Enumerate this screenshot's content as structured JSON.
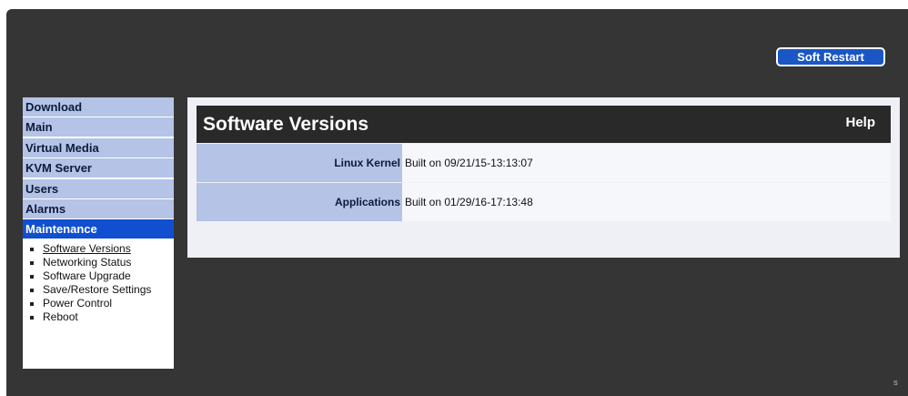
{
  "header": {
    "soft_restart_label": "Soft Restart"
  },
  "sidebar": {
    "items": [
      {
        "label": "Download"
      },
      {
        "label": "Main"
      },
      {
        "label": "Virtual Media"
      },
      {
        "label": "KVM Server"
      },
      {
        "label": "Users"
      },
      {
        "label": "Alarms"
      },
      {
        "label": "Maintenance",
        "active": true
      }
    ],
    "subitems": [
      {
        "label": "Software Versions",
        "current": true
      },
      {
        "label": "Networking Status"
      },
      {
        "label": "Software Upgrade"
      },
      {
        "label": "Save/Restore Settings"
      },
      {
        "label": "Power Control"
      },
      {
        "label": "Reboot"
      }
    ]
  },
  "main": {
    "title": "Software Versions",
    "help_label": "Help",
    "rows": [
      {
        "label": "Linux Kernel",
        "value": "Built on 09/21/15-13:13:07"
      },
      {
        "label": "Applications",
        "value": "Built on 01/29/16-17:13:48"
      }
    ]
  },
  "footer": {
    "corner_text": "S"
  },
  "colors": {
    "frame_bg": "#353535",
    "nav_bg": "#b4c3e6",
    "nav_active": "#1050d0",
    "button_bg": "#1a56c4",
    "title_bar": "#292929"
  }
}
